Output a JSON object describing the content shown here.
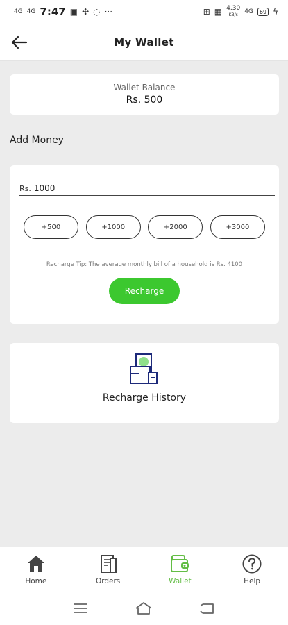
{
  "status_bar": {
    "signal1": "4G",
    "signal2": "4G",
    "time": "7:47",
    "net_speed_value": "4.30",
    "net_speed_unit": "KB/s",
    "signal3": "4G",
    "battery": "69"
  },
  "header": {
    "title": "My Wallet"
  },
  "balance": {
    "label": "Wallet Balance",
    "value": "Rs. 500"
  },
  "add_money": {
    "section_label": "Add Money",
    "currency_prefix": "Rs.",
    "amount_value": "1000",
    "presets": [
      "+500",
      "+1000",
      "+2000",
      "+3000"
    ],
    "tip": "Recharge Tip: The average monthly bill of a household is Rs. 4100",
    "recharge_label": "Recharge"
  },
  "history": {
    "label": "Recharge History"
  },
  "bottom_nav": {
    "items": [
      {
        "label": "Home",
        "icon": "home-icon"
      },
      {
        "label": "Orders",
        "icon": "orders-icon"
      },
      {
        "label": "Wallet",
        "icon": "wallet-icon"
      },
      {
        "label": "Help",
        "icon": "help-icon"
      }
    ],
    "active": "Wallet"
  },
  "colors": {
    "accent_green": "#3cc82f",
    "active_tab": "#63bd45",
    "background": "#ececec",
    "icon_navy": "#1d2a7a"
  }
}
